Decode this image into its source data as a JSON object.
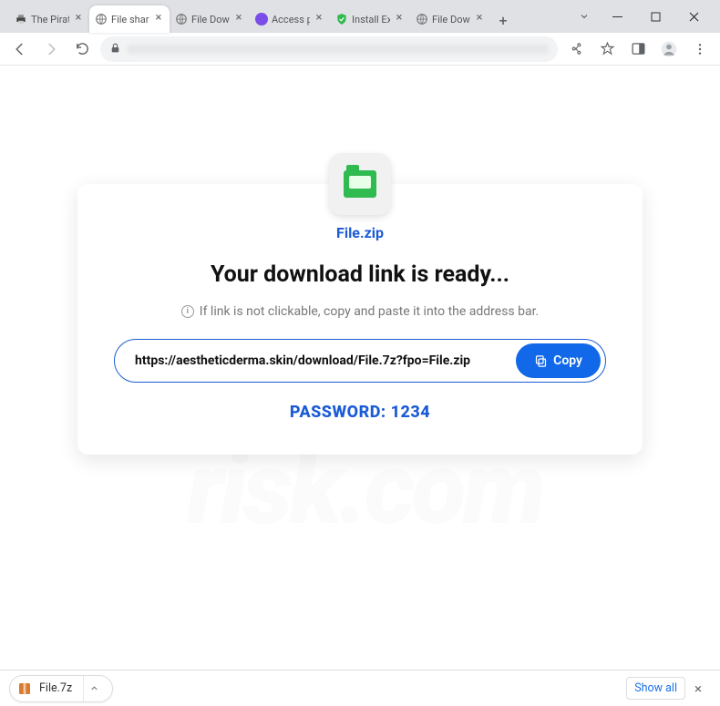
{
  "window": {
    "tabs": [
      {
        "title": "The Pirate",
        "favicon": "printer"
      },
      {
        "title": "File shari",
        "favicon": "globe",
        "active": true
      },
      {
        "title": "File Down",
        "favicon": "globe"
      },
      {
        "title": "Access po",
        "favicon": "purple"
      },
      {
        "title": "Install Ext",
        "favicon": "shield"
      },
      {
        "title": "File Down",
        "favicon": "globe"
      }
    ]
  },
  "page": {
    "filename": "File.zip",
    "headline": "Your download link is ready...",
    "hint": "If link is not clickable, copy and paste it into the address bar.",
    "url": "https://aestheticderma.skin/download/File.7z?fpo=File.zip",
    "copy_label": "Copy",
    "password_label": "PASSWORD:",
    "password_value": "1234"
  },
  "downloads": {
    "item": "File.7z",
    "show_all": "Show all"
  }
}
